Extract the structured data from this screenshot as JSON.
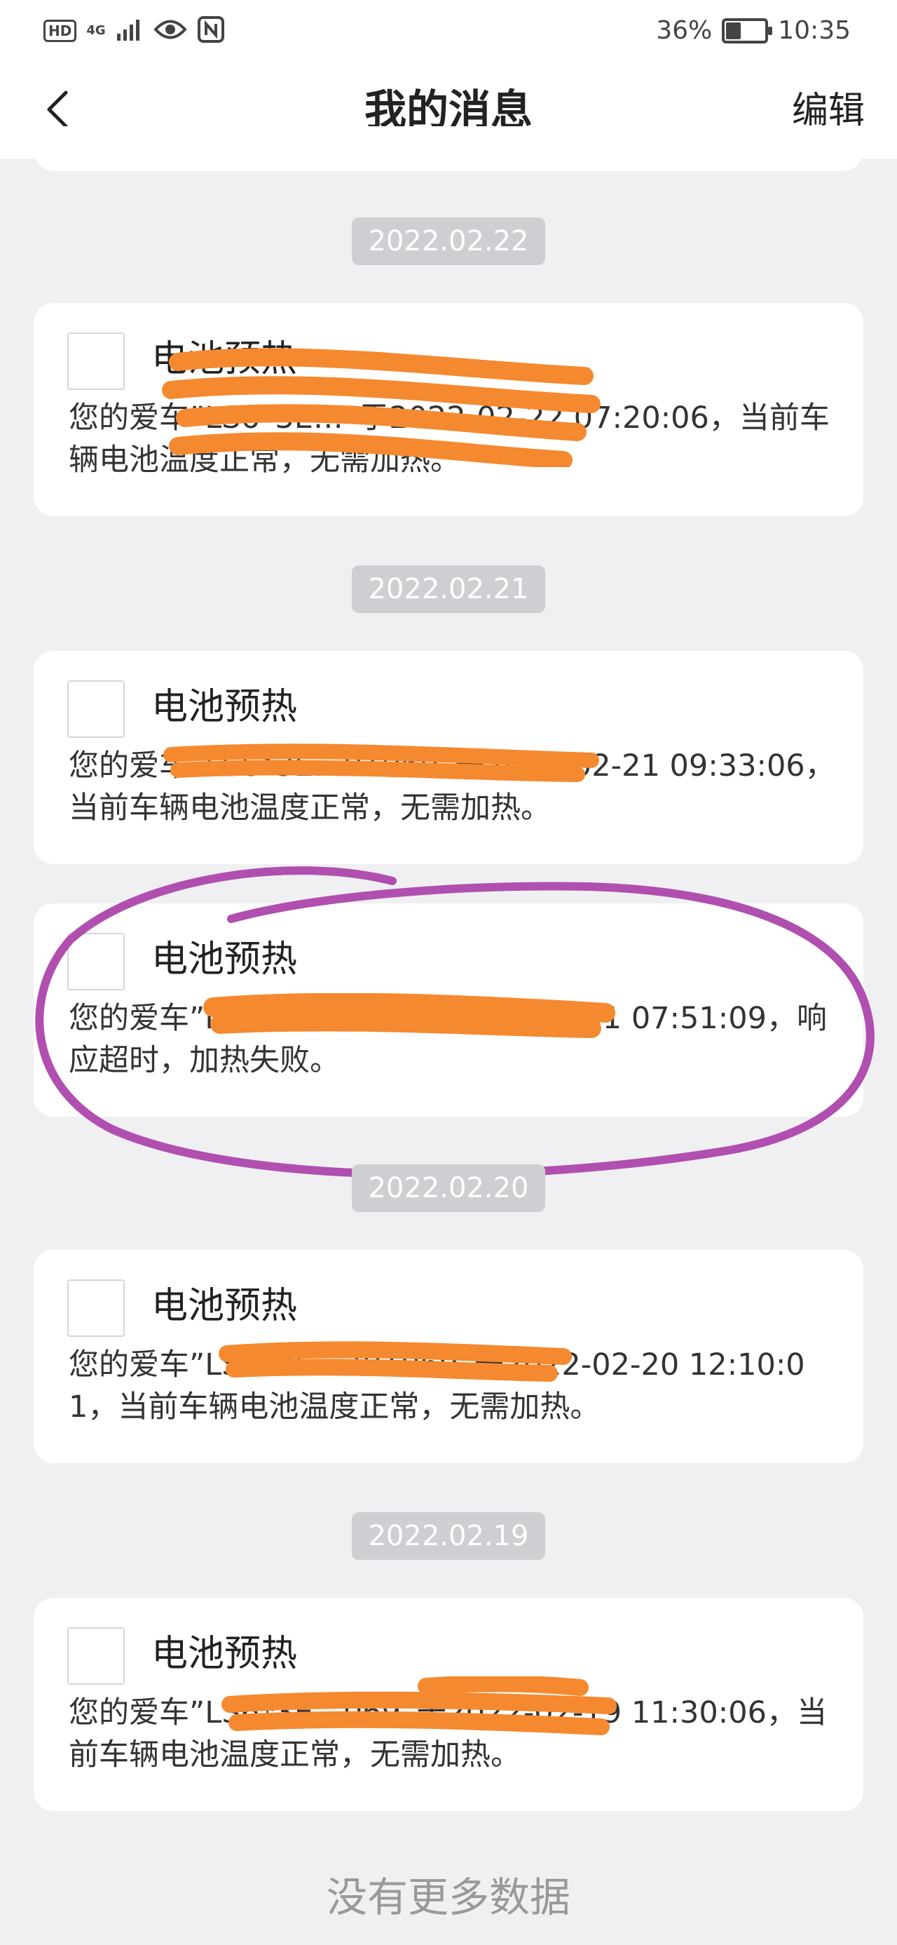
{
  "status_bar": {
    "left_badges": [
      "HD",
      "4G"
    ],
    "battery_percent": "36%",
    "battery_level": 0.36,
    "time": "10:35"
  },
  "header": {
    "title": "我的消息",
    "edit_label": "编辑",
    "back_icon": "chevron-left-icon"
  },
  "groups": [
    {
      "date": "2022.02.22",
      "messages": [
        {
          "title": "电池预热",
          "body": "您的爱车”LS6*3E…“于2022-02-22 07:20:06，当前车辆电池温度正常，无需加热。"
        }
      ]
    },
    {
      "date": "2022.02.21",
      "messages": [
        {
          "title": "电池预热",
          "body": "您的爱车”LS6*3E…01069“于2022-02-21 09:33:06，当前车辆电池温度正常，无需加热。"
        },
        {
          "title": "电池预热",
          "body": "您的爱车”LS6*3E…069“于2022-02-21 07:51:09，响应超时，加热失败。"
        }
      ]
    },
    {
      "date": "2022.02.20",
      "messages": [
        {
          "title": "电池预热",
          "body": "您的爱车”LS6*3E…701069“于2022-02-20 12:10:01，当前车辆电池温度正常，无需加热。"
        }
      ]
    },
    {
      "date": "2022.02.19",
      "messages": [
        {
          "title": "电池预热",
          "body": "您的爱车”LS6*3E…069“于2022-02-19 11:30:06，当前车辆电池温度正常，无需加热。"
        }
      ]
    }
  ],
  "footer": {
    "no_more_text": "没有更多数据"
  },
  "colors": {
    "background": "#f0f0f2",
    "date_pill": "#cfcfd3",
    "redaction": "#f5892f",
    "annotation": "#b04fb0"
  }
}
